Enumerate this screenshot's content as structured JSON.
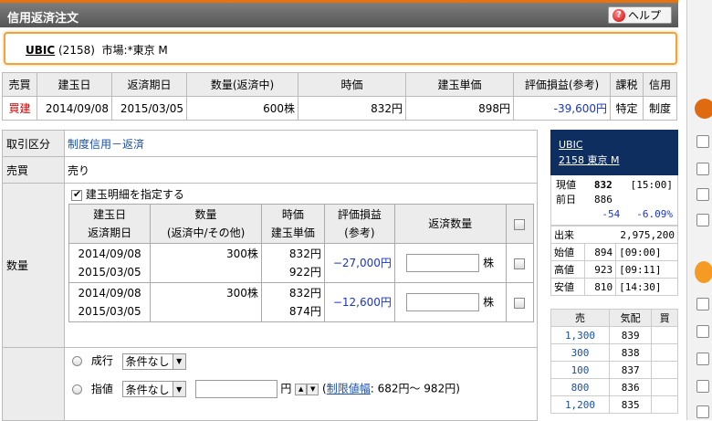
{
  "title": "信用返済注文",
  "help_label": "ヘルプ",
  "help_icon": "?",
  "stock": {
    "code_name": "UBIC",
    "code": "(2158)",
    "market": "市場:*東京 M"
  },
  "positions": {
    "headers": [
      "売買",
      "建玉日",
      "返済期日",
      "数量(返済中)",
      "時価",
      "建玉単価",
      "評価損益(参考)",
      "課税",
      "信用"
    ],
    "row": [
      "買建",
      "2014/09/08",
      "2015/03/05",
      "600株",
      "832円",
      "898円",
      "-39,600円",
      "特定",
      "制度"
    ]
  },
  "order": {
    "type_label": "取引区分",
    "type_value": "制度信用－返済",
    "side_label": "売買",
    "side_value": "売り",
    "qty_label": "数量",
    "specify_label": "建玉明細を指定する",
    "detail_headers": {
      "date1": "建玉日",
      "date2": "返済期日",
      "qty1": "数量",
      "qty2": "(返済中/その他)",
      "price1": "時価",
      "price2": "建玉単価",
      "pl1": "評価損益",
      "pl2": "(参考)",
      "return_qty": "返済数量"
    },
    "details": [
      {
        "date": "2014/09/08",
        "due": "2015/03/05",
        "qty": "300株",
        "price": "832円",
        "unit": "922円",
        "pl": "−27,000円",
        "unit_label": "株"
      },
      {
        "date": "2014/09/08",
        "due": "2015/03/05",
        "qty": "300株",
        "price": "832円",
        "unit": "874円",
        "pl": "−12,600円",
        "unit_label": "株"
      }
    ],
    "market_label": "成行",
    "limit_label": "指値",
    "cond_none": "条件なし",
    "yen": "円",
    "range_link": "制限値幅",
    "range_value": ": 682円～ 982円)",
    "range_open": "("
  },
  "quote": {
    "name": "UBIC",
    "sub": "2158 東京 M",
    "current_label": "現値",
    "current": "832",
    "current_time": "[15:00]",
    "prev_label": "前日",
    "prev": "886",
    "change": "-54",
    "change_pct": "-6.09%",
    "stats": [
      {
        "label": "出来",
        "value": "2,975,200",
        "time": ""
      },
      {
        "label": "始値",
        "value": "894",
        "time": "[09:00]"
      },
      {
        "label": "高値",
        "value": "923",
        "time": "[09:11]"
      },
      {
        "label": "安値",
        "value": "810",
        "time": "[14:30]"
      }
    ],
    "book_headers": [
      "売",
      "気配",
      "買"
    ],
    "book": [
      {
        "sell": "1,300",
        "price": "839"
      },
      {
        "sell": "300",
        "price": "838"
      },
      {
        "sell": "100",
        "price": "837"
      },
      {
        "sell": "800",
        "price": "836"
      },
      {
        "sell": "1,200",
        "price": "835"
      }
    ]
  },
  "colors": {
    "accent": "#e8730c",
    "header_bg": "#0d2e5f",
    "negative": "#1a35c8"
  }
}
